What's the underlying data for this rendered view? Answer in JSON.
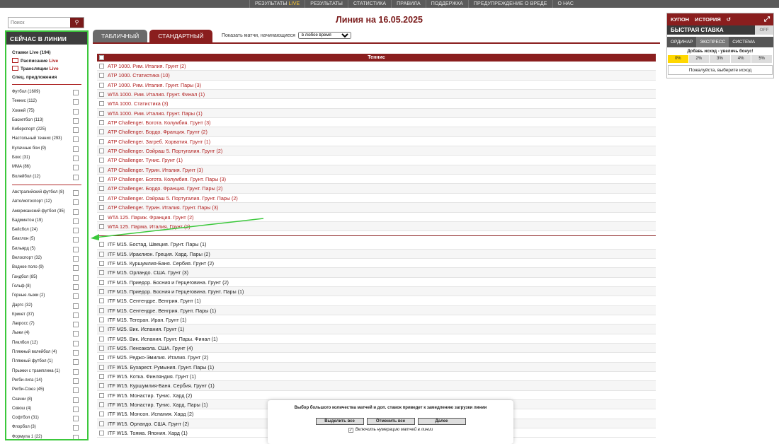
{
  "topnav": [
    {
      "label": "Результаты ",
      "live": "LIVE"
    },
    {
      "label": "Результаты",
      "live": ""
    },
    {
      "label": "Статистика",
      "live": ""
    },
    {
      "label": "Правила",
      "live": ""
    },
    {
      "label": "Поддержка",
      "live": ""
    },
    {
      "label": "Предупреждение о вреде",
      "live": ""
    },
    {
      "label": "О нас",
      "live": ""
    }
  ],
  "search": {
    "placeholder": "Поиск"
  },
  "left": {
    "header": "СЕЙЧАС В ЛИНИИ",
    "links": {
      "bets_live": "Ставки Live (194)",
      "schedule": "Расписание",
      "schedule_live": "Live",
      "broadcasts": "Трансляции",
      "broadcasts_live": "Live",
      "special": "Спец. предложения"
    },
    "sports1": [
      "Футбол (1609)",
      "Теннис (112)",
      "Хоккей (75)",
      "Баскетбол (113)",
      "Киберспорт (225)",
      "Настольный теннис (293)",
      "Кулачные бои (9)",
      "Бокс (31)",
      "MMA (86)",
      "Волейбол (12)"
    ],
    "sports2": [
      "Австралийский футбол (8)",
      "Авто/мотоспорт (12)",
      "Американский футбол (35)",
      "Бадминтон (19)",
      "Бейсбол (24)",
      "Биатлон (5)",
      "Бильярд (5)",
      "Велоспорт (32)",
      "Водное поло (9)",
      "Гандбол (85)",
      "Гольф (8)",
      "Горные лыжи (2)",
      "Дартс (32)",
      "Крикет (37)",
      "Лакросс (7)",
      "Лыжи (4)",
      "Пиклбол (12)",
      "Пляжный волейбол (4)",
      "Пляжный футбол (1)",
      "Прыжки с трамплина (1)",
      "Регби-лига (14)",
      "Регби-Союз (45)",
      "Скачки (8)",
      "Сквош (4)",
      "Софтбол (31)",
      "Флорбол (3)",
      "Формула 1 (22)"
    ]
  },
  "main": {
    "title": "Линия на 16.05.2025",
    "tabs": [
      "ТАБЛИЧНЫЙ",
      "СТАНДАРТНЫЙ"
    ],
    "show_label": "Показать матчи, начинающиеся",
    "show_value": "в любое время",
    "table_header": "Теннис",
    "group1": [
      "ATP 1000. Рим. Италия. Грунт (2)",
      "ATP 1000. Статистика (10)",
      "ATP 1000. Рим. Италия. Грунт. Пары (3)",
      "WTA 1000. Рим. Италия. Грунт. Финал (1)",
      "WTA 1000. Статистика (3)",
      "WTA 1000. Рим. Италия. Грунт. Пары (1)",
      "ATP Challenger. Богота. Колумбия. Грунт (3)",
      "ATP Challenger. Бордо. Франция. Грунт (2)",
      "ATP Challenger. Загреб. Хорватия. Грунт (1)",
      "ATP Challenger. Оэйраш 5. Португалия. Грунт (2)",
      "ATP Challenger. Тунис. Грунт (1)",
      "ATP Challenger. Турин. Италия. Грунт (3)",
      "ATP Challenger. Богота. Колумбия. Грунт. Пары (3)",
      "ATP Challenger. Бордо. Франция. Грунт. Пары (2)",
      "ATP Challenger. Оэйраш 5. Португалия. Грунт. Пары (2)",
      "ATP Challenger. Турин. Италия. Грунт. Пары (3)",
      "WTA 125. Париж. Франция. Грунт (2)",
      "WTA 125. Парма. Италия. Грунт (2)"
    ],
    "group2": [
      "ITF M15. Бостад. Швеция. Грунт. Пары (1)",
      "ITF M15. Ираклион. Греция. Хард. Пары (2)",
      "ITF M15. Куршумлия-Баня. Сербия. Грунт (2)",
      "ITF M15. Орландо. США. Грунт (3)",
      "ITF M15. Приедор. Босния и Герцеговина. Грунт (2)",
      "ITF M15. Приедор. Босния и Герцеговина. Грунт. Пары (1)",
      "ITF M15. Сентендре. Венгрия. Грунт (1)",
      "ITF M15. Сентендре. Венгрия. Грунт. Пары (1)",
      "ITF M15. Тегеран. Иран. Грунт (1)",
      "ITF M25. Вик. Испания. Грунт (1)",
      "ITF M25. Вик. Испания. Грунт. Пары. Финал (1)",
      "ITF M25. Пенсакола. США. Грунт (4)",
      "ITF M25. Реджо-Эмилия. Италия. Грунт (2)",
      "ITF W15. Бухарест. Румыния. Грунт. Пары (1)",
      "ITF W15. Котка. Финляндия. Грунт (1)",
      "ITF W15. Куршумлия-Баня. Сербия. Грунт (1)",
      "ITF W15. Монастир. Тунис. Хард (2)",
      "ITF W15. Монастир. Тунис. Хард. Пары (1)",
      "ITF W15. Монсон. Испания. Хард (2)",
      "ITF W15. Орландо. США. Грунт (2)",
      "ITF W15. Тояма. Япония. Хард (1)"
    ]
  },
  "coupon": {
    "tab_coupon": "КУПОН",
    "tab_history": "ИСТОРИЯ",
    "fast_bet": "БЫСТРАЯ СТАВКА",
    "off": "OFF",
    "modes": [
      "ОРДИНАР",
      "ЭКСПРЕСС",
      "СИСТЕМА"
    ],
    "bonus_text": "Добавь исход - увеличь бонус!",
    "percents": [
      "0%",
      "2%",
      "3%",
      "4%",
      "5%"
    ],
    "choose_text": "Пожалуйста, выберите исход"
  },
  "popup": {
    "message": "Выбор большого количества матчей и доп. ставок приведет к замедлению загрузки линии",
    "btn_select_all": "Выделить все",
    "btn_cancel_all": "Отменить все",
    "btn_next": "Далее",
    "numbering": "Включить нумерацию матчей в линии"
  },
  "colors": {
    "brand": "#8a1e1e",
    "highlight": "#3cc83c",
    "accent": "#ffd700"
  }
}
